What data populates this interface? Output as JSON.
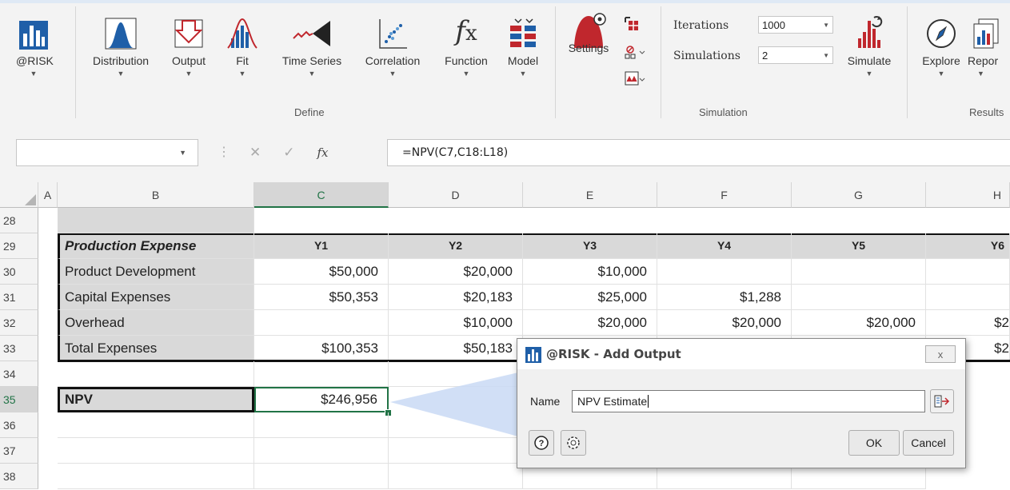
{
  "ribbon": {
    "buttons": [
      {
        "label": "@RISK",
        "icon": "risk-logo-icon"
      },
      {
        "label": "Distribution",
        "icon": "distribution-icon"
      },
      {
        "label": "Output",
        "icon": "output-icon"
      },
      {
        "label": "Fit",
        "icon": "fit-icon"
      },
      {
        "label": "Time Series",
        "icon": "time-series-icon"
      },
      {
        "label": "Correlation",
        "icon": "correlation-icon"
      },
      {
        "label": "Function",
        "icon": "function-icon"
      },
      {
        "label": "Model",
        "icon": "model-icon"
      },
      {
        "label": "Settings",
        "icon": "settings-icon"
      },
      {
        "label": "Simulate",
        "icon": "simulate-icon"
      },
      {
        "label": "Explore",
        "icon": "explore-icon"
      },
      {
        "label": "Repor",
        "icon": "report-icon"
      }
    ],
    "groups": {
      "define": "Define",
      "simulation": "Simulation",
      "results": "Results"
    },
    "iterations_label": "Iterations",
    "iterations_value": "1000",
    "simulations_label": "Simulations",
    "simulations_value": "2"
  },
  "formula_bar": {
    "name_box": "",
    "fx": "fx",
    "formula": "=NPV(C7,C18:L18)"
  },
  "sheet": {
    "columns": [
      "A",
      "B",
      "C",
      "D",
      "E",
      "F",
      "G",
      "H"
    ],
    "rows": [
      "28",
      "29",
      "30",
      "31",
      "32",
      "33",
      "34",
      "35",
      "36",
      "37",
      "38"
    ],
    "header_row": {
      "label": "Production Expense",
      "years": [
        "Y1",
        "Y2",
        "Y3",
        "Y4",
        "Y5",
        "Y6"
      ]
    },
    "data": [
      {
        "label": "Product Development",
        "values": [
          "$50,000",
          "$20,000",
          "$10,000",
          "",
          "",
          ""
        ]
      },
      {
        "label": "Capital Expenses",
        "values": [
          "$50,353",
          "$20,183",
          "$25,000",
          "$1,288",
          "",
          ""
        ]
      },
      {
        "label": "Overhead",
        "values": [
          "",
          "$10,000",
          "$20,000",
          "$20,000",
          "$20,000",
          "$2"
        ]
      },
      {
        "label": "Total Expenses",
        "values": [
          "$100,353",
          "$50,183",
          "",
          "",
          "",
          "$2"
        ]
      }
    ],
    "npv": {
      "label": "NPV",
      "value": "$246,956"
    }
  },
  "dialog": {
    "title": "@RISK - Add Output",
    "close": "x",
    "name_label": "Name",
    "name_value": "NPV Estimate",
    "ok": "OK",
    "cancel": "Cancel"
  },
  "colors": {
    "accent": "#217346",
    "risk_red": "#c0272d",
    "risk_blue": "#1f5fa8"
  }
}
